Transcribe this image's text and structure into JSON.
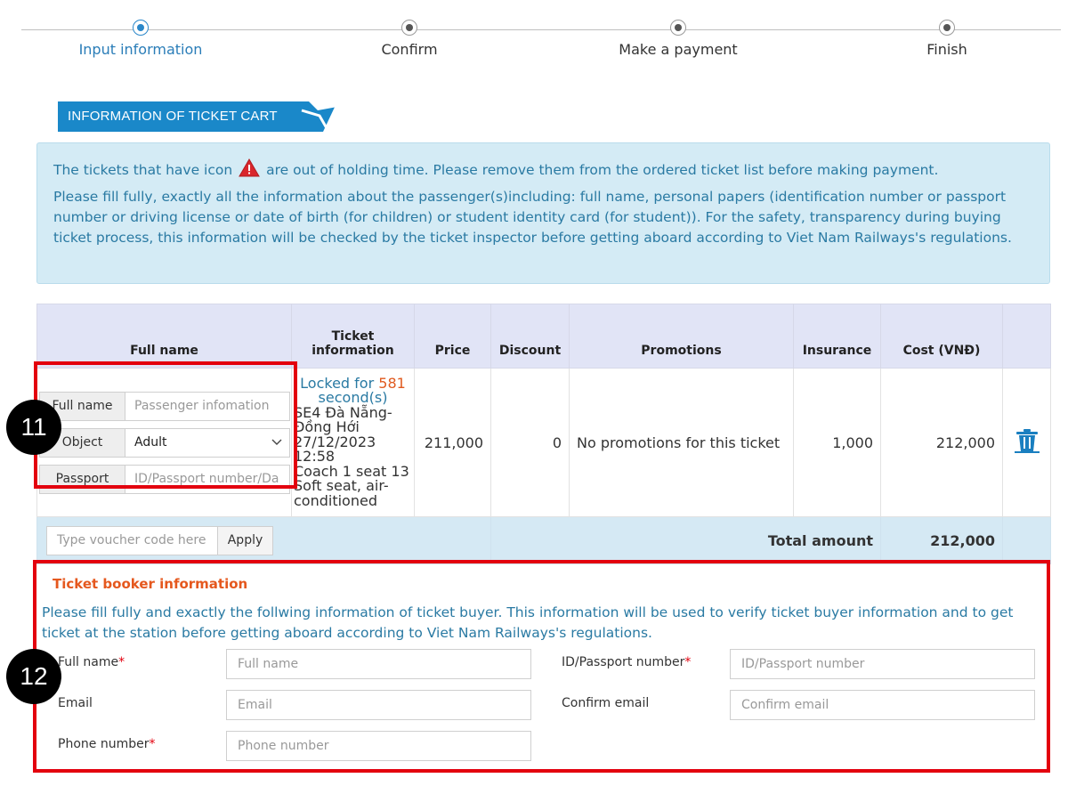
{
  "stepper": {
    "steps": [
      {
        "label": "Input information",
        "active": true
      },
      {
        "label": "Confirm",
        "active": false
      },
      {
        "label": "Make a payment",
        "active": false
      },
      {
        "label": "Finish",
        "active": false
      }
    ]
  },
  "cart": {
    "section_title": "INFORMATION OF TICKET CART",
    "notice": {
      "line1_before_icon": "The tickets that have icon",
      "line1_after_icon": "are out of holding time. Please remove them from the ordered ticket list before making payment.",
      "line2": "Please fill fully, exactly all the information about the passenger(s)including: full name, personal papers (identification number or passport number or driving license or date of birth (for children) or student identity card (for student)). For the safety, transparency during buying ticket process, this information will be checked by the ticket inspector before getting aboard according to Viet Nam Railways's regulations."
    },
    "table": {
      "headers": {
        "full_name": "Full name",
        "ticket_info": "Ticket information",
        "price": "Price",
        "discount": "Discount",
        "promotions": "Promotions",
        "insurance": "Insurance",
        "cost": "Cost (VNĐ)"
      },
      "row": {
        "passenger": {
          "full_name_label": "Full name",
          "full_name_placeholder": "Passenger infomation",
          "object_label": "Object",
          "object_value": "Adult",
          "passport_label": "Passport",
          "passport_placeholder": "ID/Passport number/Da"
        },
        "ticket": {
          "locked_prefix": "Locked for",
          "locked_seconds": "581",
          "locked_suffix": "second(s)",
          "train": "SE4 Đà Nẵng-Đồng Hới",
          "datetime": "27/12/2023 12:58",
          "seat": "Coach 1 seat 13",
          "seat_type": "Soft seat, air-conditioned"
        },
        "price": "211,000",
        "discount": "0",
        "promotions": "No promotions for this ticket",
        "insurance": "1,000",
        "cost": "212,000",
        "delete_icon": "trash-icon"
      },
      "voucher": {
        "placeholder": "Type voucher code here",
        "apply_label": "Apply"
      },
      "total_label": "Total amount",
      "total_value": "212,000"
    }
  },
  "annotations": {
    "badge_11": "11",
    "badge_12": "12",
    "highlight_color": "#e3000e"
  },
  "booker": {
    "title": "Ticket booker information",
    "note": "Please fill fully and exactly the follwing information of ticket buyer. This information will be used to verify ticket buyer information and to get ticket at the station before getting aboard according to Viet Nam Railways's regulations.",
    "full_name_label": "Full name",
    "full_name_placeholder": "Full name",
    "id_label": "ID/Passport number",
    "id_placeholder": "ID/Passport number",
    "email_label": "Email",
    "email_placeholder": "Email",
    "confirm_email_label": "Confirm email",
    "confirm_email_placeholder": "Confirm email",
    "phone_label": "Phone number",
    "phone_placeholder": "Phone number",
    "required_mark": "*"
  },
  "colors": {
    "accent_blue": "#1a88c9",
    "notice_bg": "#d4ebf5",
    "notice_text": "#2a7aa3",
    "header_bg": "#e1e4f6",
    "booker_title": "#e5581e",
    "warning_icon": "#d9262c"
  }
}
